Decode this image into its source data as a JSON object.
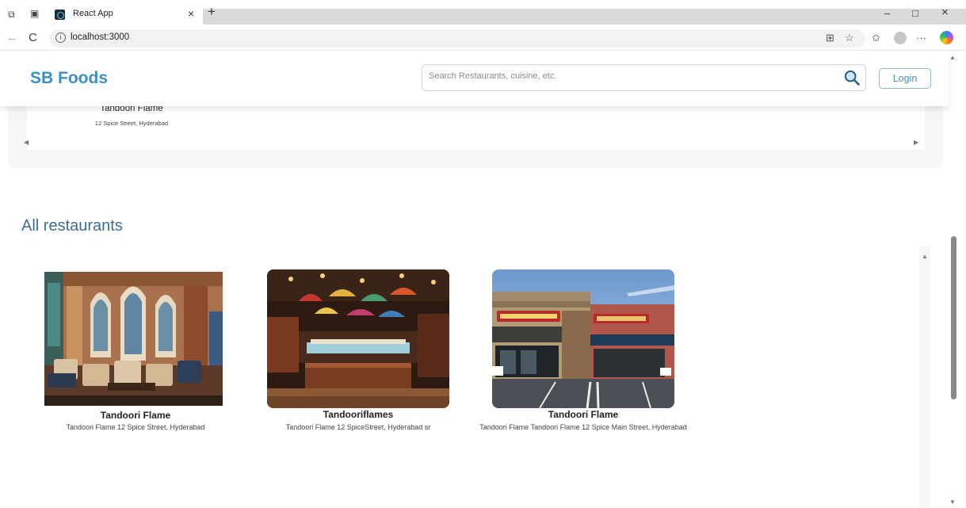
{
  "browser": {
    "tab_title": "React App",
    "tab_close": "×",
    "new_tab": "+",
    "url": "localhost:3000",
    "info_glyph": "i",
    "back": "←",
    "reload": "C",
    "more": "···",
    "minimize": "–",
    "restore": "□",
    "close": "×"
  },
  "header": {
    "logo": "SB Foods",
    "search_placeholder": "Search Restaurants, cuisine, etc.",
    "login_label": "Login"
  },
  "popular": {
    "item": {
      "name": "Tandoori Flame",
      "address": "12 Spice Street, Hyderabad"
    }
  },
  "all_restaurants": {
    "title": "All restaurants",
    "items": [
      {
        "name": "Tandoori Flame",
        "address": "Tandoori Flame 12 Spice Street, Hyderabad",
        "image": "restaurant-interior-image"
      },
      {
        "name": "Tandooriflames",
        "address": "Tandoori Flame 12 SpiceStreet, Hyderabad sr",
        "image": "buffet-interior-image"
      },
      {
        "name": "Tandoori Flame",
        "address": "Tandoori Flame Tandoori Flame 12 Spice Main Street, Hyderabad",
        "image": "storefront-exterior-image"
      }
    ]
  },
  "colors": {
    "brand": "#3d8fc1",
    "section_title": "#3a6e92",
    "login_border": "#8fb8cf"
  }
}
